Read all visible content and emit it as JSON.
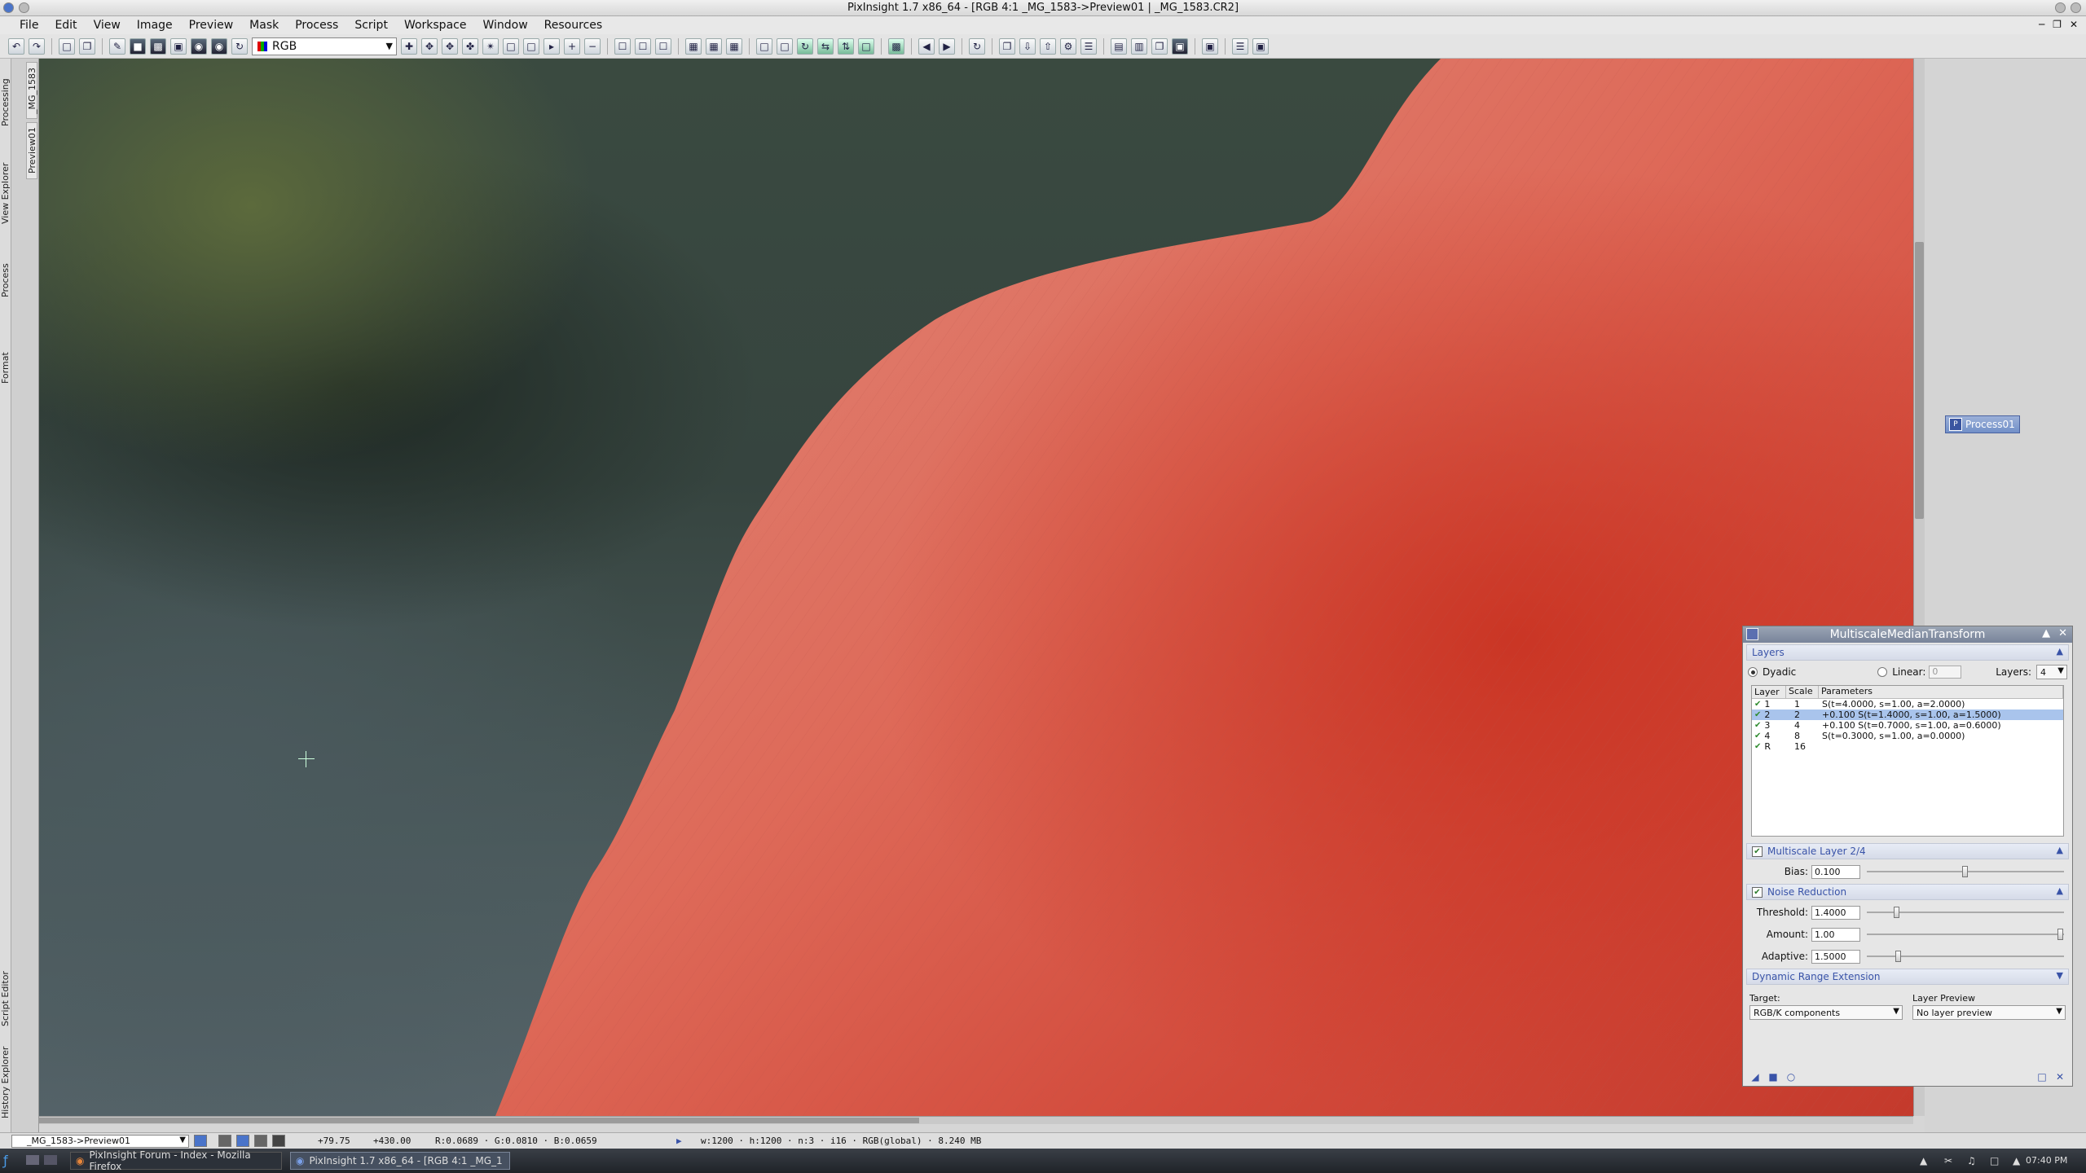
{
  "window": {
    "title": "PixInsight 1.7 x86_64 - [RGB 4:1 _MG_1583->Preview01 | _MG_1583.CR2]"
  },
  "menu": [
    "File",
    "Edit",
    "View",
    "Image",
    "Preview",
    "Mask",
    "Process",
    "Script",
    "Workspace",
    "Window",
    "Resources"
  ],
  "toolbar": {
    "channel_select": "RGB"
  },
  "left_dock": {
    "top_tabs": [
      "Processing Console",
      "View Explorer",
      "Process Explorer",
      "Format Explorer"
    ],
    "bottom_tabs": [
      "Script Editor",
      "History Explorer"
    ],
    "image_tabs": [
      "_MG_1583",
      "Preview01"
    ]
  },
  "workspace": {
    "process_icon_label": "Process01"
  },
  "mmt": {
    "title": "MultiscaleMedianTransform",
    "layers_section": "Layers",
    "dyadic_label": "Dyadic",
    "linear_label": "Linear:",
    "linear_value": "0",
    "layers_label": "Layers:",
    "layers_value": "4",
    "table_headers": [
      "Layer",
      "Scale",
      "Parameters"
    ],
    "table_rows": [
      {
        "layer": "1",
        "scale": "1",
        "params": "S(t=4.0000, s=1.00, a=2.0000)",
        "checked": true,
        "selected": false
      },
      {
        "layer": "2",
        "scale": "2",
        "params": "+0.100 S(t=1.4000, s=1.00, a=1.5000)",
        "checked": true,
        "selected": true
      },
      {
        "layer": "3",
        "scale": "4",
        "params": "+0.100 S(t=0.7000, s=1.00, a=0.6000)",
        "checked": true,
        "selected": false
      },
      {
        "layer": "4",
        "scale": "8",
        "params": "S(t=0.3000, s=1.00, a=0.0000)",
        "checked": true,
        "selected": false
      },
      {
        "layer": "R",
        "scale": "16",
        "params": "",
        "checked": true,
        "selected": false
      }
    ],
    "multiscale_layer_section": "Multiscale Layer 2/4",
    "bias_label": "Bias:",
    "bias_value": "0.100",
    "bias_fraction": 0.5,
    "noise_reduction_section": "Noise Reduction",
    "threshold_label": "Threshold:",
    "threshold_value": "1.4000",
    "threshold_fraction": 0.14,
    "amount_label": "Amount:",
    "amount_value": "1.00",
    "amount_fraction": 1.0,
    "adaptive_label": "Adaptive:",
    "adaptive_value": "1.5000",
    "adaptive_fraction": 0.15,
    "dre_section": "Dynamic Range Extension",
    "target_label": "Target:",
    "target_value": "RGB/K components",
    "layer_preview_label": "Layer Preview",
    "layer_preview_value": "No layer preview"
  },
  "statusbar": {
    "view": "_MG_1583->Preview01",
    "x": "+79.75",
    "y": "+430.00",
    "rgb": "R:0.0689 · G:0.0810 · B:0.0659",
    "info": "w:1200 · h:1200 · n:3 · i16 · RGB(global) · 8.240 MB"
  },
  "taskbar": {
    "tasks": [
      "PixInsight Forum - Index - Mozilla Firefox",
      "PixInsight 1.7 x86_64 - [RGB 4:1 _MG_1"
    ],
    "clock": "07:40 PM"
  }
}
